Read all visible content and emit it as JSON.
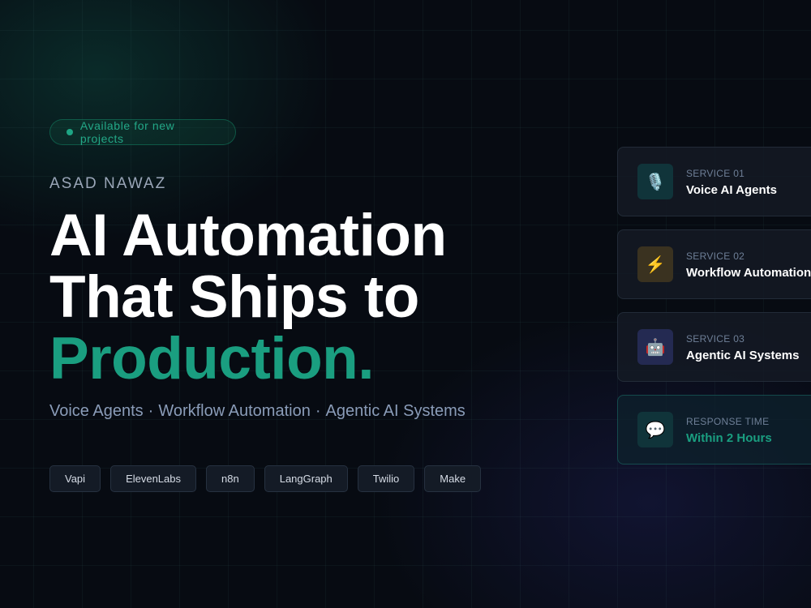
{
  "availability": {
    "text": "Available for new projects",
    "dot_color": "#1ea584"
  },
  "profile": {
    "name": "ASAD NAWAZ"
  },
  "headline": {
    "line1": "AI Automation",
    "line2": "That Ships to",
    "line3": "Production.",
    "accent_color": "#1a9e80"
  },
  "subtitle": {
    "items": [
      "Voice Agents",
      "Workflow Automation",
      "Agentic AI Systems"
    ],
    "separator": "·"
  },
  "tags": [
    "Vapi",
    "ElevenLabs",
    "n8n",
    "LangGraph",
    "Twilio",
    "Make"
  ],
  "cards": [
    {
      "label": "SERVICE 01",
      "title": "Voice AI Agents",
      "icon": "microphone-icon",
      "glyph": "🎙️",
      "icon_bg": "#10343a"
    },
    {
      "label": "SERVICE 02",
      "title": "Workflow Automation",
      "icon": "lightning-icon",
      "glyph": "⚡",
      "icon_bg": "#3a3220"
    },
    {
      "label": "SERVICE 03",
      "title": "Agentic AI Systems",
      "icon": "robot-icon",
      "glyph": "🤖",
      "icon_bg": "#242a52"
    },
    {
      "label": "RESPONSE TIME",
      "title": "Within 2 Hours",
      "icon": "chat-bubble-icon",
      "glyph": "💬",
      "icon_bg": "#10343a"
    }
  ]
}
